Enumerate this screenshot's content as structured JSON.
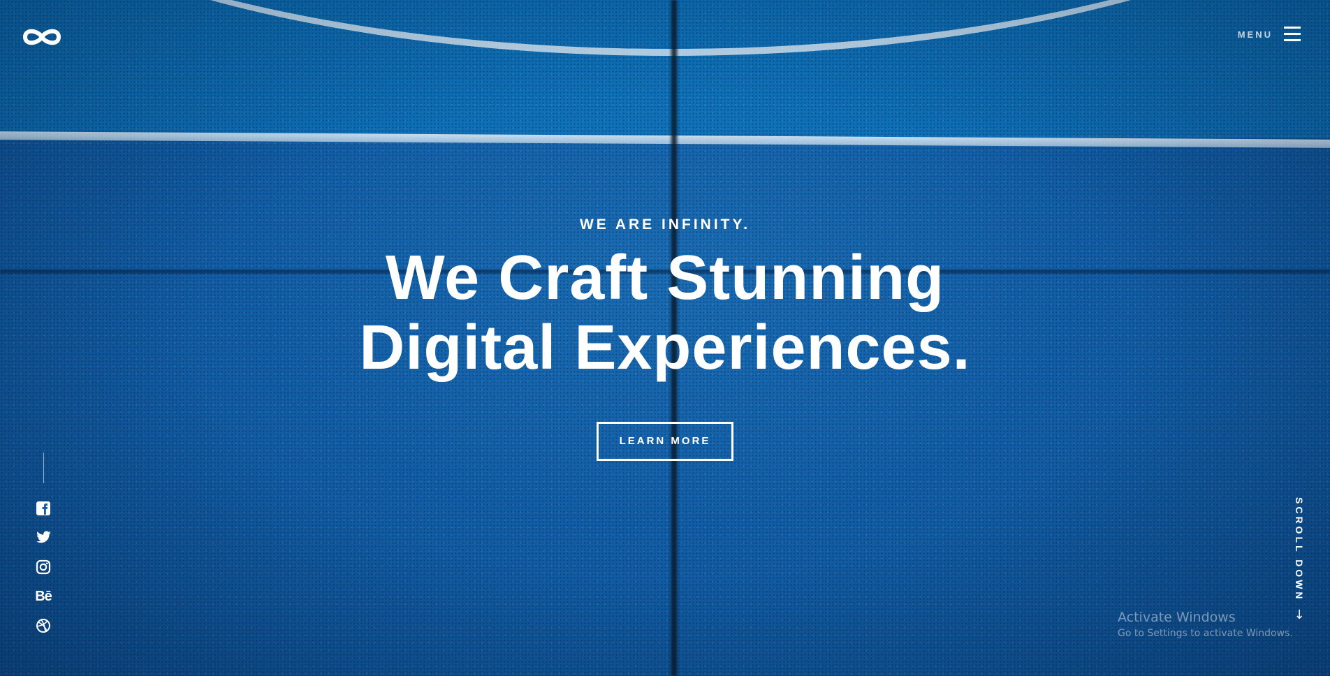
{
  "brand": {
    "logo_icon": "infinity-icon"
  },
  "header": {
    "menu_label": "MENU",
    "menu_icon": "hamburger-icon"
  },
  "hero": {
    "eyebrow": "WE ARE INFINITY.",
    "headline_line1": "We Craft Stunning",
    "headline_line2": "Digital Experiences.",
    "cta_label": "LEARN MORE"
  },
  "social": [
    {
      "icon": "facebook-icon"
    },
    {
      "icon": "twitter-icon"
    },
    {
      "icon": "instagram-icon"
    },
    {
      "icon": "behance-icon",
      "glyph": "Bē"
    },
    {
      "icon": "dribbble-icon"
    }
  ],
  "scroll": {
    "label": "SCROLL DOWN",
    "arrow": "↓"
  },
  "os_watermark": {
    "title": "Activate Windows",
    "subtitle": "Go to Settings to activate Windows."
  },
  "colors": {
    "court_blue": "#125ea6",
    "top_band_blue": "#0b7cc2",
    "text": "#ffffff"
  }
}
